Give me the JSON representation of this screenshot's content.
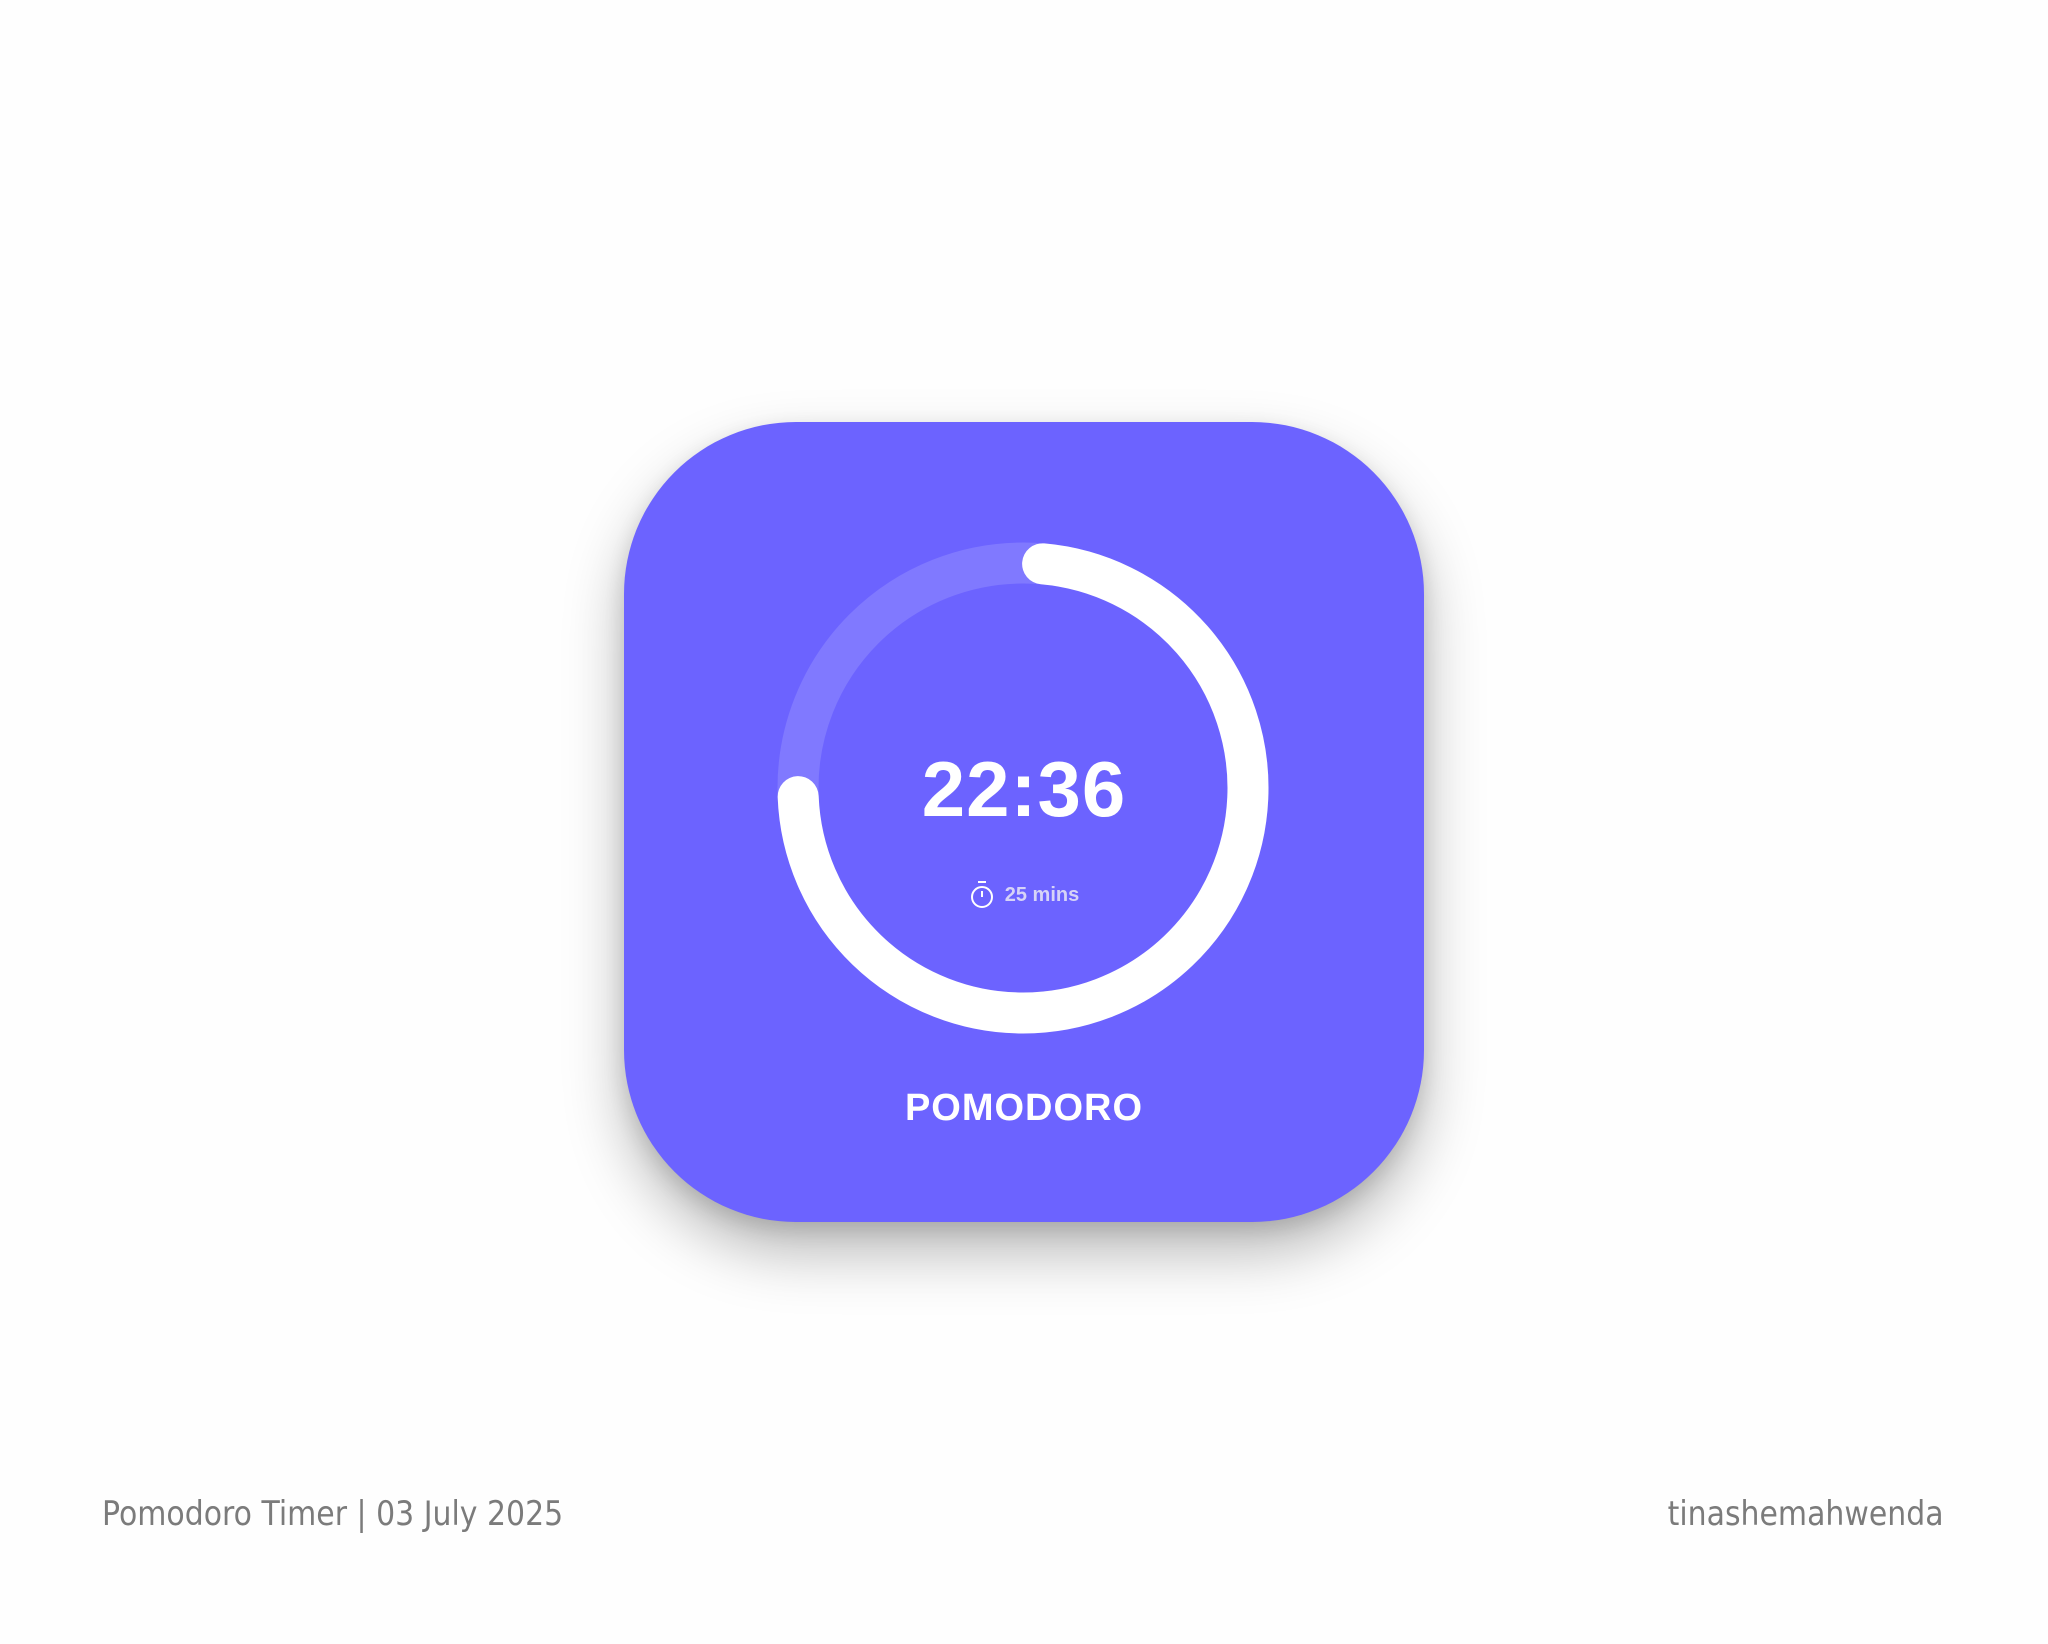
{
  "timer": {
    "remaining": "22:36",
    "duration_label": "25 mins",
    "mode_label": "POMODORO",
    "progress_fraction": 0.73,
    "icon": "stopwatch-icon"
  },
  "colors": {
    "card": "#6c63ff",
    "track": "#8079ff",
    "progress": "#ffffff"
  },
  "footer": {
    "title": "Pomodoro Timer | 03 July 2025",
    "author": "tinashemahwenda"
  }
}
